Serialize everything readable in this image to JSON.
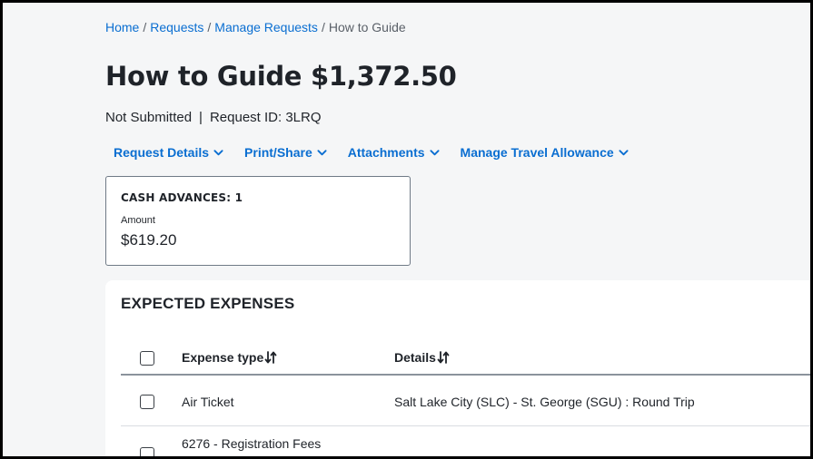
{
  "breadcrumb": {
    "items": [
      "Home",
      "Requests",
      "Manage Requests"
    ],
    "current": "How to Guide",
    "separator": "/"
  },
  "header": {
    "title": "How to Guide $1,372.50",
    "status": "Not Submitted",
    "divider": "|",
    "request_id": "Request ID: 3LRQ"
  },
  "menu": {
    "items": [
      "Request Details",
      "Print/Share",
      "Attachments",
      "Manage Travel Allowance"
    ],
    "icon": "chevron-down-icon"
  },
  "cash_advances": {
    "title": "CASH ADVANCES: 1",
    "amount_label": "Amount",
    "amount_value": "$619.20"
  },
  "expected_expenses": {
    "title": "EXPECTED EXPENSES",
    "columns": [
      "Expense type",
      "Details"
    ],
    "sort_icon": "sort-icon",
    "rows": [
      {
        "expense_type": "Air Ticket",
        "details": "Salt Lake City (SLC) - St. George (SGU) : Round Trip"
      },
      {
        "expense_type": "6276 - Registration Fees",
        "details": ""
      }
    ]
  },
  "colors": {
    "link": "#0a6ed1",
    "text": "#1f2329",
    "background": "#f5f6f7"
  }
}
